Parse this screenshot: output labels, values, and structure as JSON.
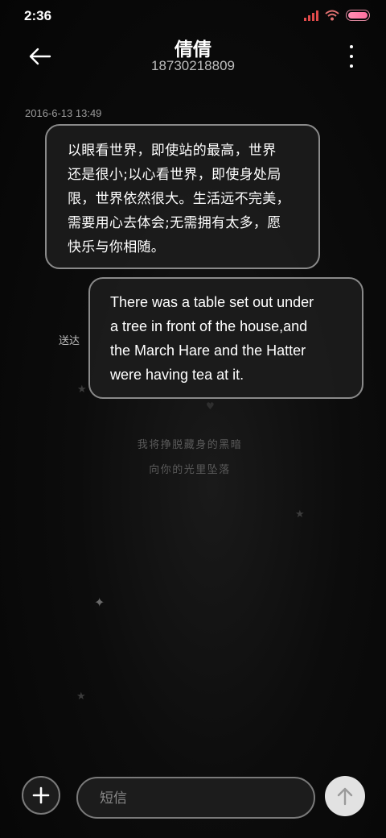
{
  "status_bar": {
    "time": "2:36"
  },
  "header": {
    "contact_name": "倩倩",
    "phone_number": "18730218809"
  },
  "conversation": {
    "timestamp": "2016-6-13 13:49",
    "messages": [
      {
        "direction": "incoming",
        "lines": [
          "以眼看世界，即使站的最高，世界",
          "还是很小;以心看世界，即使身处局",
          "限，世界依然很大。生活远不完美，",
          "需要用心去体会;无需拥有太多，愿",
          "快乐与你相随。"
        ]
      },
      {
        "direction": "outgoing",
        "lines": [
          "There was a table set out under",
          "a tree in front of the house,and",
          "the March Hare and the Hatter",
          "were having tea at it."
        ],
        "status": "送达"
      }
    ]
  },
  "background": {
    "poem_line_1": "我将挣脱藏身的黑暗",
    "poem_line_2": "向你的光里坠落"
  },
  "composer": {
    "placeholder": "短信"
  },
  "icons": {
    "back": "arrow-left-icon",
    "more": "more-vertical-icon",
    "add": "plus-icon",
    "send": "arrow-up-icon",
    "signal": "signal-icon",
    "wifi": "wifi-icon",
    "battery": "battery-icon"
  },
  "colors": {
    "background": "#0c0c0c",
    "bubble_border": "#8a8a8a",
    "signal": "#e04a4a",
    "battery": "#ff6f9f"
  }
}
